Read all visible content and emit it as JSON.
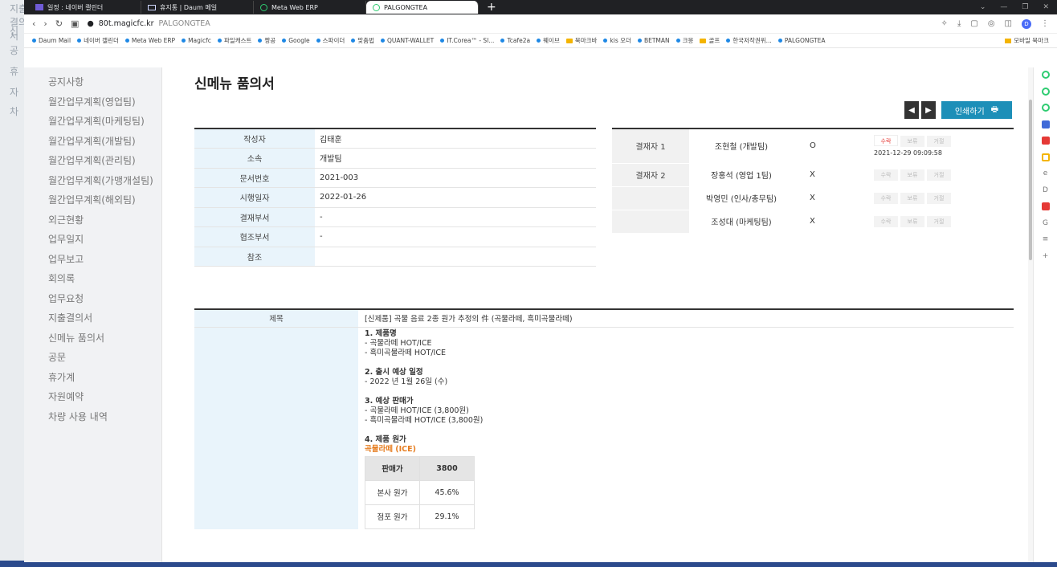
{
  "background": {
    "ghost_labels": [
      "지출결의서",
      "신",
      "공",
      "휴",
      "자",
      "차"
    ]
  },
  "browser": {
    "tabs": [
      {
        "label": "일정 : 네이버 캘린더",
        "icon": "calendar-icon",
        "active": false
      },
      {
        "label": "휴지통 | Daum 메일",
        "icon": "mail-icon",
        "active": false
      },
      {
        "label": "Meta Web ERP",
        "icon": "circle-icon",
        "active": false
      },
      {
        "label": "PALGONGTEA",
        "icon": "circle-icon",
        "active": true
      }
    ],
    "new_tab": "+",
    "url_host": "80t.magicfc.kr",
    "url_path": "PALGONGTEA",
    "bookmarks": [
      "Daum Mail",
      "네이버 캘린더",
      "Meta Web ERP",
      "Magicfc",
      "파일캐스트",
      "짱공",
      "Google",
      "스파이더",
      "맞춤법",
      "QUANT-WALLET",
      "IT.Corea™ - Sl...",
      "Tcafe2a",
      "웨이브",
      "북마크바",
      "kis 오더",
      "BETMAN",
      "크몽",
      "골프",
      "한국저작권위...",
      "PALGONGTEA"
    ],
    "mobile_bookmarks": "모바일 북마크",
    "profile_initial": "D"
  },
  "sidebar": {
    "items": [
      "공지사항",
      "월간업무계획(영업팀)",
      "월간업무계획(마케팅팀)",
      "월간업무계획(개발팀)",
      "월간업무계획(관리팀)",
      "월간업무계획(가맹개설팀)",
      "월간업무계획(해외팀)",
      "외근현황",
      "업무일지",
      "업무보고",
      "회의록",
      "업무요청",
      "지출결의서",
      "신메뉴 품의서",
      "공문",
      "휴가계",
      "자원예약",
      "차량 사용 내역"
    ]
  },
  "main": {
    "title": "신메뉴 품의서",
    "prev": "◀",
    "next": "▶",
    "print_label": "인쇄하기",
    "info": [
      {
        "label": "작성자",
        "value": "김태훈"
      },
      {
        "label": "소속",
        "value": "개발팀"
      },
      {
        "label": "문서번호",
        "value": "2021-003"
      },
      {
        "label": "시행일자",
        "value": "2022-01-26"
      },
      {
        "label": "결재부서",
        "value": "-"
      },
      {
        "label": "협조부서",
        "value": "-"
      },
      {
        "label": "참조",
        "value": ""
      }
    ],
    "approvals": [
      {
        "label": "결재자 1",
        "name": "조현철 (개발팀)",
        "status": "O",
        "timestamp": "2021-12-29 09:09:58",
        "accepted": true
      },
      {
        "label": "결재자 2",
        "name": "장홍석 (영업 1팀)",
        "status": "X",
        "timestamp": "",
        "accepted": false
      },
      {
        "label": "",
        "name": "박영민 (인사/총무팀)",
        "status": "X",
        "timestamp": "",
        "accepted": false
      },
      {
        "label": "",
        "name": "조성대 (마케팅팀)",
        "status": "X",
        "timestamp": "",
        "accepted": false
      }
    ],
    "action_labels": [
      "수락",
      "보류",
      "거절"
    ],
    "subject_label": "제목",
    "subject": "[신제품] 곡물 음료 2종 원가 추정의 件 (곡물라떼, 흑미곡물라떼)",
    "body": [
      {
        "type": "h",
        "text": "1. 제품명"
      },
      {
        "type": "p",
        "text": "- 곡물라떼 HOT/ICE"
      },
      {
        "type": "p",
        "text": "- 흑미곡물라떼 HOT/ICE"
      },
      {
        "type": "h",
        "text": "2. 출시 예상 일정"
      },
      {
        "type": "p",
        "text": "- 2022 년 1월 26일 (수)"
      },
      {
        "type": "h",
        "text": "3. 예상 판매가"
      },
      {
        "type": "p",
        "text": "- 곡물라떼 HOT/ICE (3,800원)"
      },
      {
        "type": "p",
        "text": "- 흑미곡물라떼 HOT/ICE (3,800원)"
      },
      {
        "type": "h",
        "text": "4. 제품 원가"
      },
      {
        "type": "o",
        "text": "곡물라떼 (ICE)"
      }
    ],
    "cost_table": {
      "header": [
        "판매가",
        "3800"
      ],
      "rows": [
        [
          "본사 원가",
          "45.6%"
        ],
        [
          "점포 원가",
          "29.1%"
        ]
      ]
    }
  }
}
